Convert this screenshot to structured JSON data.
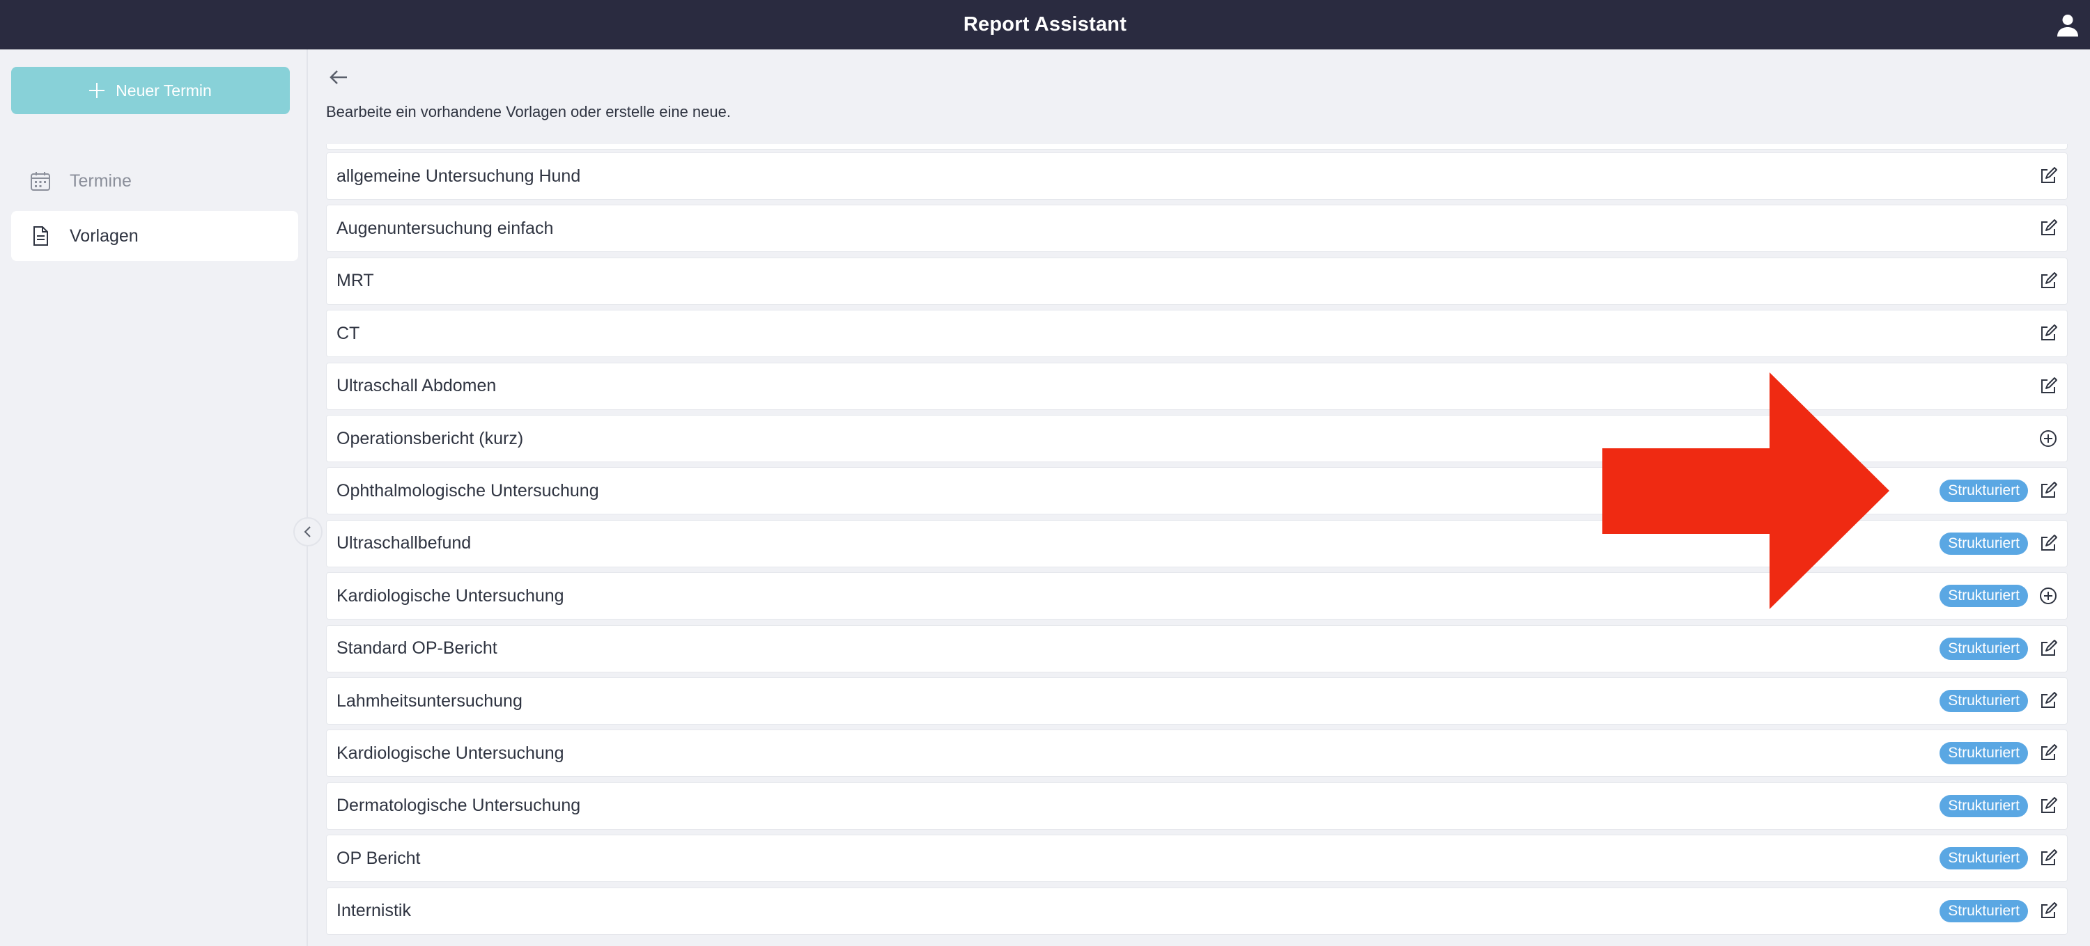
{
  "header": {
    "title": "Report Assistant",
    "user_icon": "user-icon"
  },
  "sidebar": {
    "new_button_label": "Neuer Termin",
    "items": [
      {
        "label": "Termine",
        "icon": "calendar-icon"
      },
      {
        "label": "Vorlagen",
        "icon": "document-icon"
      }
    ]
  },
  "main": {
    "subtitle": "Bearbeite ein vorhandene Vorlagen oder erstelle eine neue.",
    "badge_label": "Strukturiert",
    "templates": [
      {
        "name": "allgemeine Untersuchung Hund",
        "structured": false,
        "action": "edit"
      },
      {
        "name": "Augenuntersuchung einfach",
        "structured": false,
        "action": "edit"
      },
      {
        "name": "MRT",
        "structured": false,
        "action": "edit"
      },
      {
        "name": "CT",
        "structured": false,
        "action": "edit"
      },
      {
        "name": "Ultraschall Abdomen",
        "structured": false,
        "action": "edit"
      },
      {
        "name": "Operationsbericht (kurz)",
        "structured": false,
        "action": "add"
      },
      {
        "name": "Ophthalmologische Untersuchung",
        "structured": true,
        "action": "edit"
      },
      {
        "name": "Ultraschallbefund",
        "structured": true,
        "action": "edit"
      },
      {
        "name": "Kardiologische Untersuchung",
        "structured": true,
        "action": "add"
      },
      {
        "name": "Standard OP-Bericht",
        "structured": true,
        "action": "edit"
      },
      {
        "name": "Lahmheitsuntersuchung",
        "structured": true,
        "action": "edit"
      },
      {
        "name": "Kardiologische Untersuchung",
        "structured": true,
        "action": "edit"
      },
      {
        "name": "Dermatologische Untersuchung",
        "structured": true,
        "action": "edit"
      },
      {
        "name": "OP Bericht",
        "structured": true,
        "action": "edit"
      },
      {
        "name": "Internistik",
        "structured": true,
        "action": "edit"
      }
    ]
  },
  "colors": {
    "header_bg": "#2a2b40",
    "accent_button": "#88d1d8",
    "badge": "#5aa7e3",
    "annotation_arrow": "#ef2a12"
  }
}
